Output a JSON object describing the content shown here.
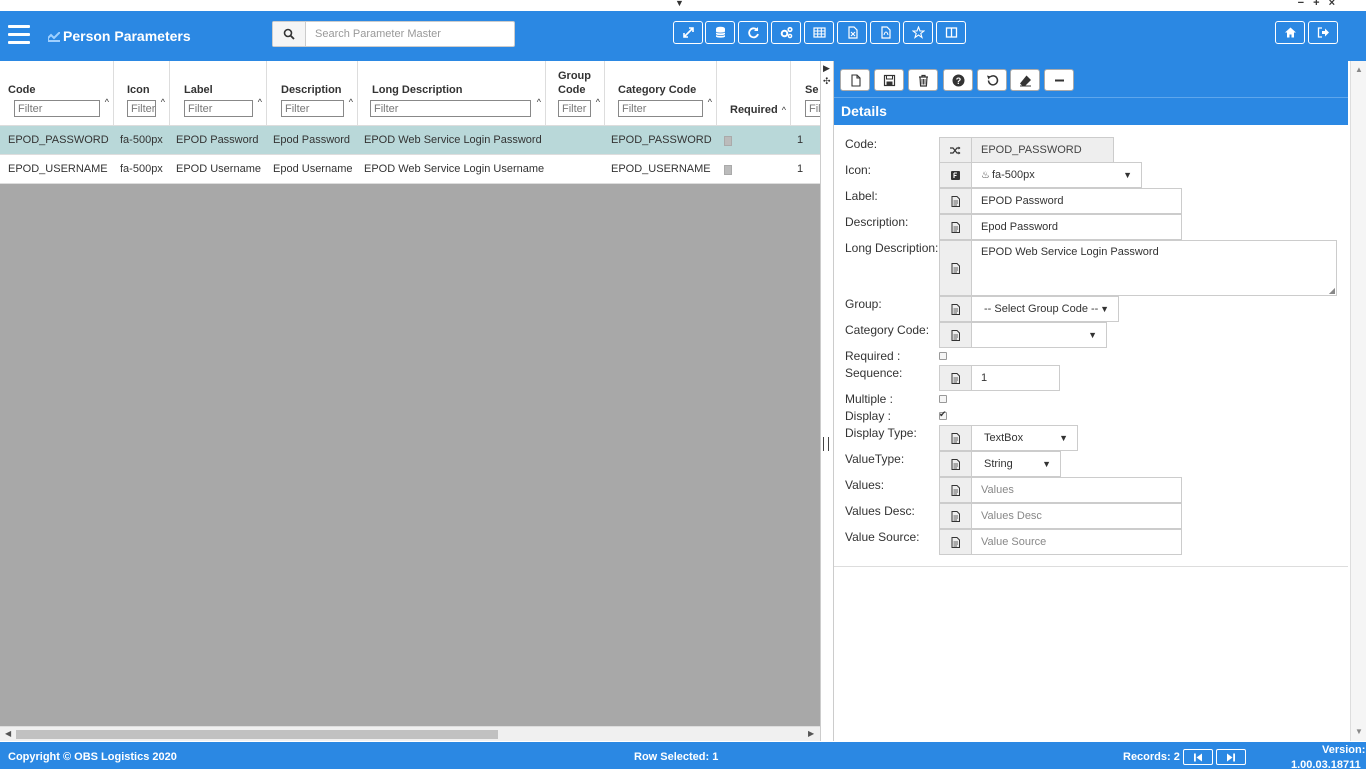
{
  "window": {
    "top_caret": "▼",
    "controls": "− + ×"
  },
  "header": {
    "title": "Person Parameters",
    "search_placeholder": "Search Parameter Master",
    "toolbar_icons": [
      "expand-icon",
      "database-icon",
      "refresh-icon",
      "cogs-icon",
      "table-icon",
      "file-export-icon",
      "file-pdf-icon",
      "star-icon",
      "columns-icon"
    ],
    "right_icons": [
      "home-icon",
      "logout-icon"
    ]
  },
  "grid": {
    "columns": [
      {
        "title": "Code",
        "filter_placeholder": "Filter"
      },
      {
        "title": "Icon",
        "filter_placeholder": "Filter"
      },
      {
        "title": "Label",
        "filter_placeholder": "Filter"
      },
      {
        "title": "Description",
        "filter_placeholder": "Filter"
      },
      {
        "title": "Long Description",
        "filter_placeholder": "Filter"
      },
      {
        "title": "Group Code",
        "filter_placeholder": "Filter"
      },
      {
        "title": "Category Code",
        "filter_placeholder": "Filter"
      },
      {
        "title": "Required"
      },
      {
        "title": "Se",
        "filter_placeholder": "Filt"
      }
    ],
    "rows": [
      {
        "code": "EPOD_PASSWORD",
        "icon": "fa-500px",
        "label": "EPOD Password",
        "description": "Epod Password",
        "long_description": "EPOD Web Service Login Password",
        "group_code": "",
        "category_code": "EPOD_PASSWORD",
        "required": false,
        "sequence": "1",
        "selected": true
      },
      {
        "code": "EPOD_USERNAME",
        "icon": "fa-500px",
        "label": "EPOD Username",
        "description": "Epod Username",
        "long_description": "EPOD Web Service Login Username",
        "group_code": "",
        "category_code": "EPOD_USERNAME",
        "required": false,
        "sequence": "1",
        "selected": false
      }
    ]
  },
  "details": {
    "title": "Details",
    "toolbar_icons": [
      "new-icon",
      "save-icon",
      "delete-icon",
      "help-icon",
      "undo-icon",
      "eraser-icon",
      "collapse-icon"
    ],
    "fields": {
      "code": {
        "label": "Code:",
        "value": "EPOD_PASSWORD"
      },
      "icon": {
        "label": "Icon:",
        "value": "fa-500px"
      },
      "label": {
        "label": "Label:",
        "value": "EPOD Password"
      },
      "description": {
        "label": "Description:",
        "value": "Epod Password"
      },
      "long_description": {
        "label": "Long Description:",
        "value": "EPOD Web Service Login Password"
      },
      "group": {
        "label": "Group:",
        "value": "-- Select Group Code --"
      },
      "category_code": {
        "label": "Category Code:",
        "value": ""
      },
      "required": {
        "label": "Required :",
        "checked": false
      },
      "sequence": {
        "label": "Sequence:",
        "value": "1"
      },
      "multiple": {
        "label": "Multiple :",
        "checked": false
      },
      "display": {
        "label": "Display :",
        "checked": true
      },
      "display_type": {
        "label": "Display Type:",
        "value": "TextBox"
      },
      "value_type": {
        "label": "ValueType:",
        "value": "String"
      },
      "values": {
        "label": "Values:",
        "placeholder": "Values"
      },
      "values_desc": {
        "label": "Values Desc:",
        "placeholder": "Values Desc"
      },
      "value_source": {
        "label": "Value Source:",
        "placeholder": "Value Source"
      }
    }
  },
  "footer": {
    "copyright": "Copyright © OBS Logistics 2020",
    "row_selected": "Row Selected: 1",
    "records": "Records: 2",
    "version_label": "Version:",
    "version": "1.00.03.18711"
  },
  "colors": {
    "primary": "#2b88e3",
    "selected_row": "#b9d8d9",
    "grid_empty": "#a8a8a8"
  }
}
